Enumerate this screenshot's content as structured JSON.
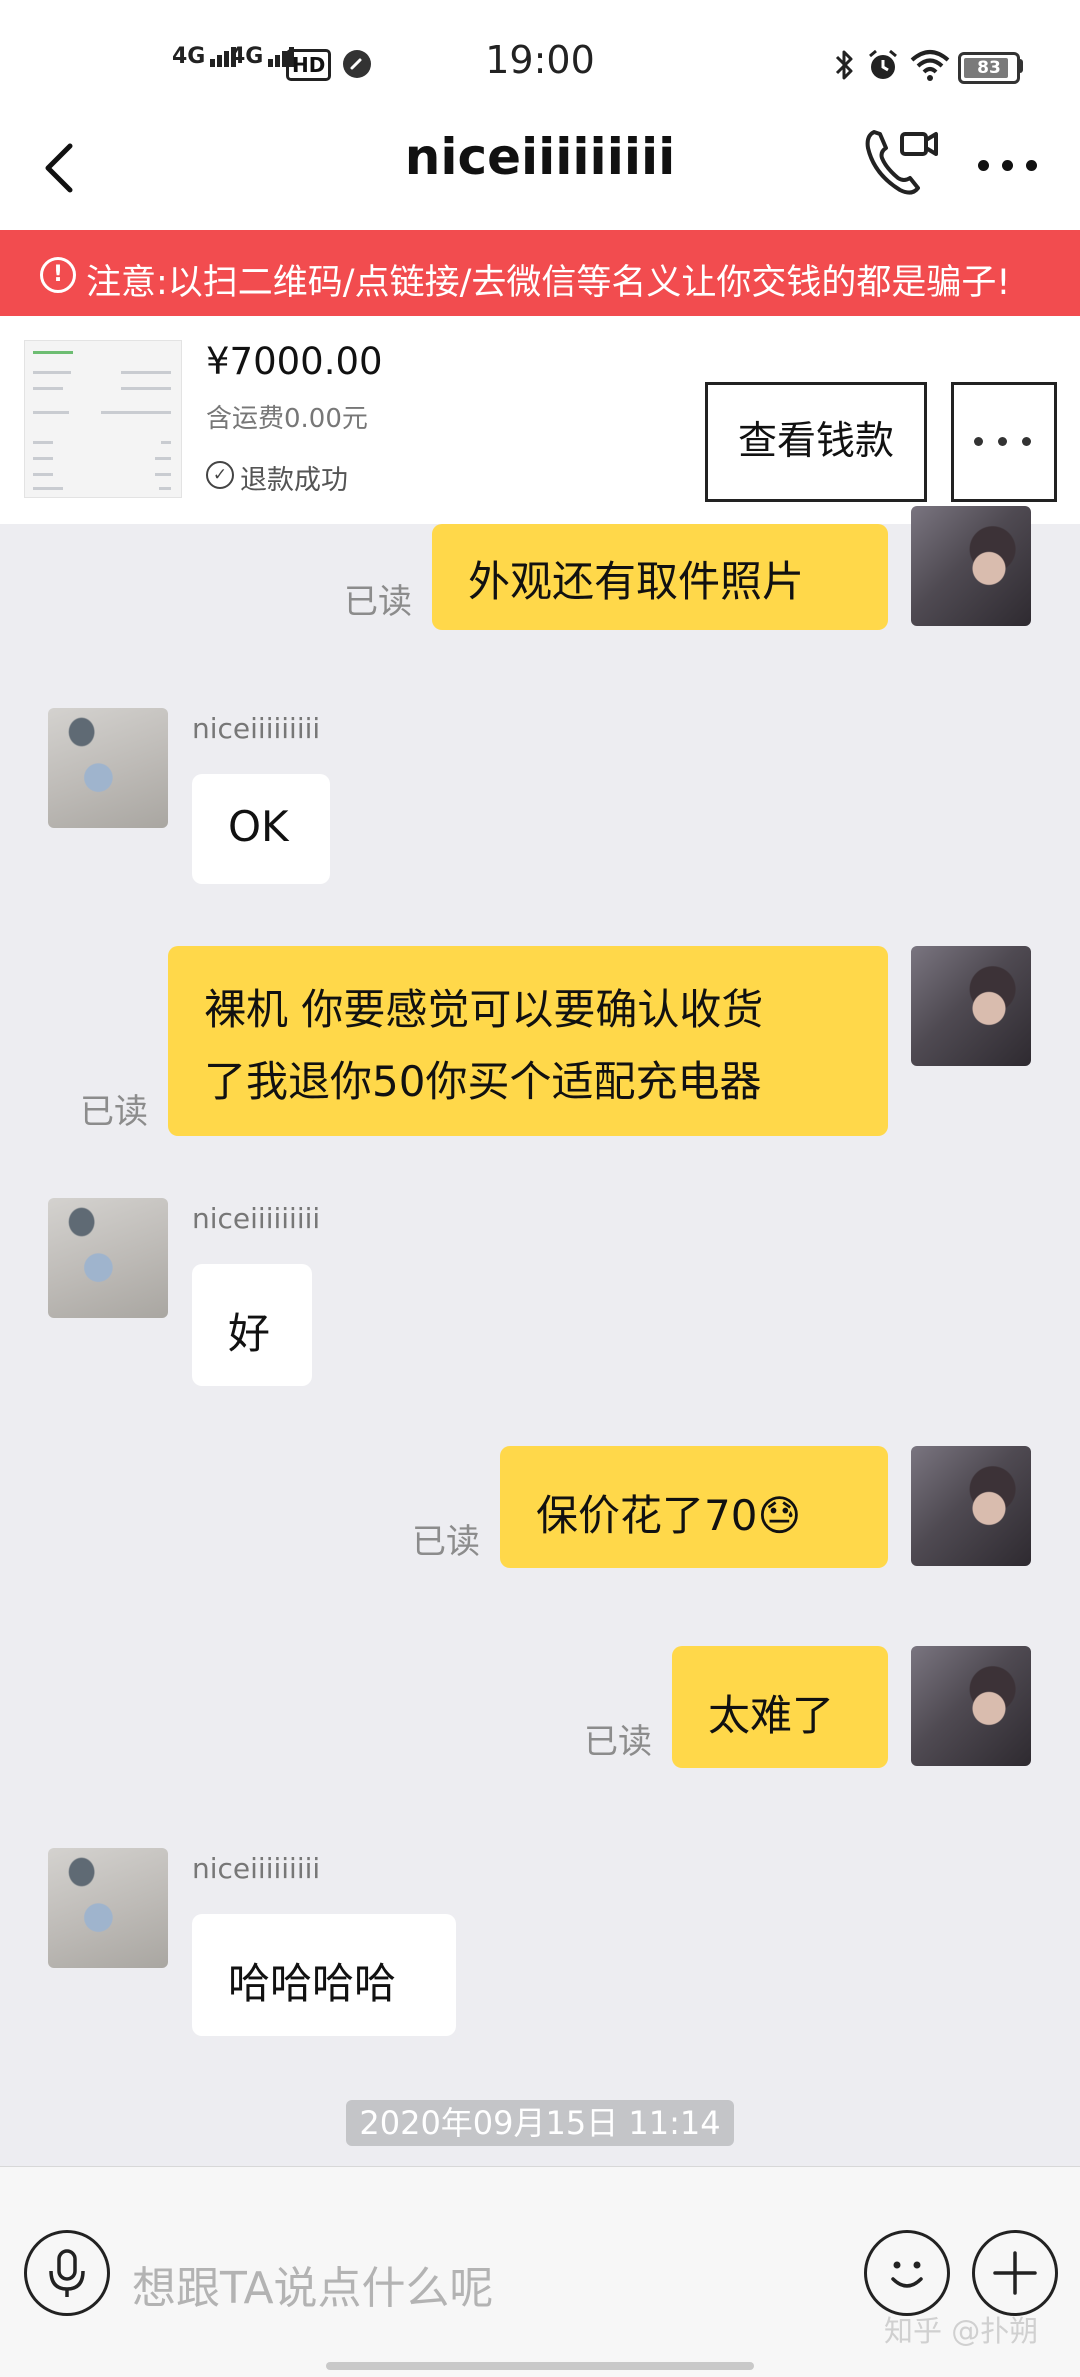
{
  "status_bar": {
    "time": "19:00",
    "signal1": "4G",
    "signal2": "4G",
    "hd": "HD",
    "hd_sub": "1\n2",
    "battery": "83",
    "icons": [
      "bluetooth-icon",
      "alarm-icon",
      "wifi-icon"
    ]
  },
  "header": {
    "title": "niceiiiiiiiii",
    "icons": [
      "back-arrow-icon",
      "voice-video-call-icon",
      "more-dots-icon"
    ]
  },
  "warning": {
    "icon": "!",
    "text": "注意:以扫二维码/点链接/去微信等名义让你交钱的都是骗子!"
  },
  "product": {
    "price": "¥7000.00",
    "shipping": "含运费0.00元",
    "status": "退款成功",
    "view_button": "查看钱款",
    "colors": {
      "warning": "#f24c4f",
      "my_bubble": "#ffd84a"
    }
  },
  "messages": [
    {
      "from": "me",
      "text": "外观还有取件照片",
      "read": "已读"
    },
    {
      "from": "them",
      "name": "niceiiiiiiiii",
      "text": "OK"
    },
    {
      "from": "me",
      "lines": [
        "裸机 你要感觉可以要确认收货",
        "了我退你50你买个适配充电器"
      ],
      "read": "已读"
    },
    {
      "from": "them",
      "name": "niceiiiiiiiii",
      "text": "好"
    },
    {
      "from": "me",
      "text": "保价花了70",
      "emoji": "😓",
      "read": "已读"
    },
    {
      "from": "me",
      "text": "太难了",
      "read": "已读"
    },
    {
      "from": "them",
      "name": "niceiiiiiiiii",
      "text": "哈哈哈哈"
    }
  ],
  "timestamp": "2020年09月15日 11:14",
  "input": {
    "placeholder": "想跟TA说点什么呢",
    "icons": [
      "microphone-icon",
      "emoji-icon",
      "plus-icon"
    ]
  },
  "watermark": "知乎 @扑朔"
}
